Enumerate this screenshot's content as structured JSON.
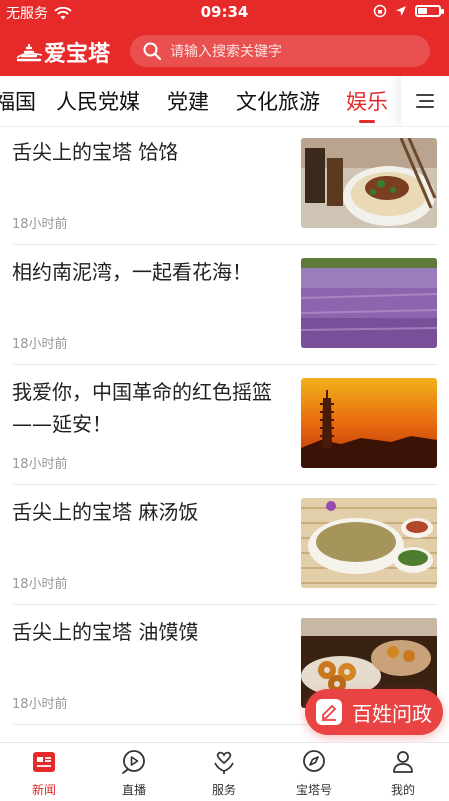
{
  "status_bar": {
    "carrier": "无服务",
    "time": "09:34"
  },
  "header": {
    "logo_text": "爱宝塔",
    "search_placeholder": "请输入搜索关键字",
    "accent_color": "#e62a2a"
  },
  "tabs": [
    {
      "label": "福国",
      "active": false
    },
    {
      "label": "人民党媒",
      "active": false
    },
    {
      "label": "党建",
      "active": false
    },
    {
      "label": "文化旅游",
      "active": false
    },
    {
      "label": "娱乐",
      "active": true
    }
  ],
  "news": [
    {
      "title": "舌尖上的宝塔 饸饹",
      "time": "18小时前",
      "thumb": "noodle-dish"
    },
    {
      "title": "相约南泥湾，一起看花海！",
      "time": "18小时前",
      "thumb": "flower-field"
    },
    {
      "title": "我爱你，中国革命的红色摇篮——延安！",
      "time": "18小时前",
      "thumb": "pagoda-sunset"
    },
    {
      "title": "舌尖上的宝塔 麻汤饭",
      "time": "18小时前",
      "thumb": "soup-bowl"
    },
    {
      "title": "舌尖上的宝塔 油馍馍",
      "time": "18小时前",
      "thumb": "fried-rings"
    }
  ],
  "float_button": {
    "label": "百姓问政"
  },
  "bottom_nav": [
    {
      "label": "新闻",
      "icon": "news-icon",
      "active": true
    },
    {
      "label": "直播",
      "icon": "play-icon",
      "active": false
    },
    {
      "label": "服务",
      "icon": "service-icon",
      "active": false
    },
    {
      "label": "宝塔号",
      "icon": "compass-icon",
      "active": false
    },
    {
      "label": "我的",
      "icon": "user-icon",
      "active": false
    }
  ]
}
